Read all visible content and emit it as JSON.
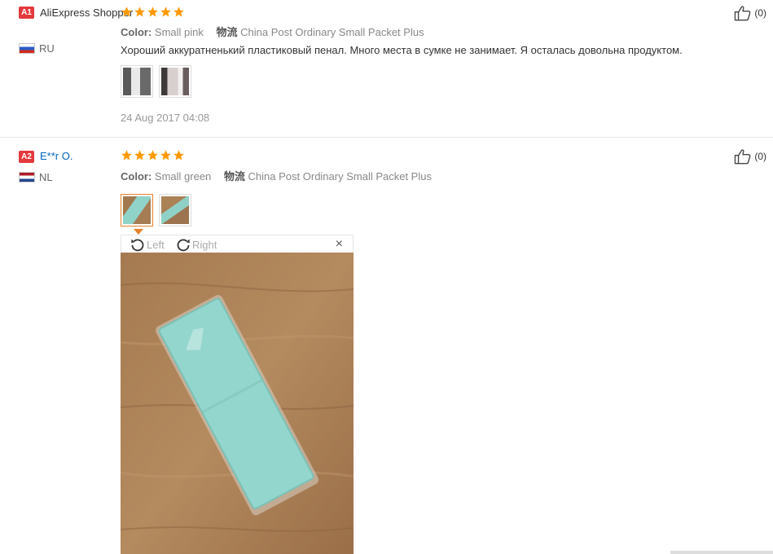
{
  "reviews": [
    {
      "badge": "A1",
      "user": "AliExpress Shopper",
      "country": "RU",
      "stars": 5,
      "color_label": "Color:",
      "color_value": "Small pink",
      "shipping_label": "物流",
      "shipping_value": "China Post Ordinary Small Packet Plus",
      "text": "Хороший аккуратненький пластиковый пенал. Много места в сумке не занимает. Я осталась довольна продуктом.",
      "date": "24 Aug 2017 04:08",
      "helpful_count": "(0)"
    },
    {
      "badge": "A2",
      "user": "E**r O.",
      "country": "NL",
      "stars": 5,
      "color_label": "Color:",
      "color_value": "Small green",
      "shipping_label": "物流",
      "shipping_value": "China Post Ordinary Small Packet Plus",
      "helpful_count": "(0)"
    }
  ],
  "viewer": {
    "rotate_left": "Left",
    "rotate_right": "Right",
    "close": "×"
  },
  "colors": {
    "badge": "#e4393c",
    "star": "#ff9900",
    "link": "#0066c0",
    "selected_border": "#e5812c"
  }
}
